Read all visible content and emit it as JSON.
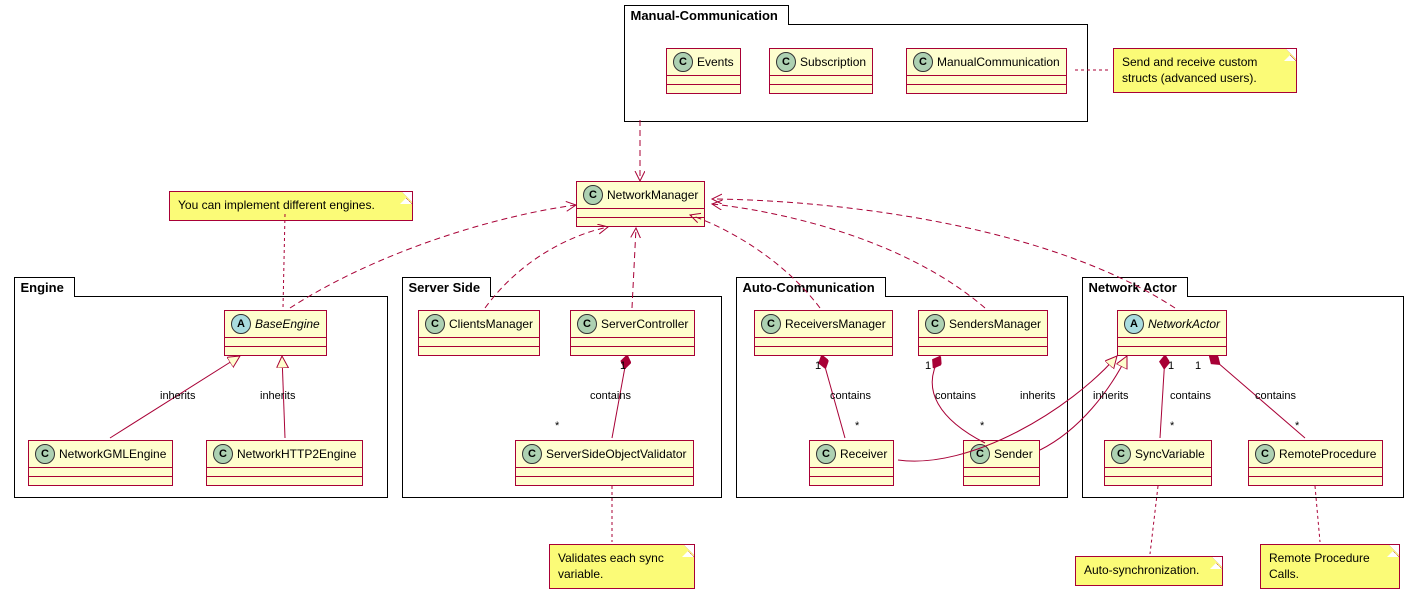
{
  "packages": {
    "manual": {
      "title": "Manual-Communication"
    },
    "engine": {
      "title": "Engine"
    },
    "server": {
      "title": "Server Side"
    },
    "auto": {
      "title": "Auto-Communication"
    },
    "actor": {
      "title": "Network Actor"
    }
  },
  "classes": {
    "events": {
      "name": "Events",
      "stereo": "C"
    },
    "subscription": {
      "name": "Subscription",
      "stereo": "C"
    },
    "manualcomm": {
      "name": "ManualCommunication",
      "stereo": "C"
    },
    "networkmgr": {
      "name": "NetworkManager",
      "stereo": "C"
    },
    "baseengine": {
      "name": "BaseEngine",
      "stereo": "A"
    },
    "gmlengine": {
      "name": "NetworkGMLEngine",
      "stereo": "C"
    },
    "http2engine": {
      "name": "NetworkHTTP2Engine",
      "stereo": "C"
    },
    "clientsmgr": {
      "name": "ClientsManager",
      "stereo": "C"
    },
    "serverctrl": {
      "name": "ServerController",
      "stereo": "C"
    },
    "ssvalidator": {
      "name": "ServerSideObjectValidator",
      "stereo": "C"
    },
    "recvmgr": {
      "name": "ReceiversManager",
      "stereo": "C"
    },
    "sendmgr": {
      "name": "SendersManager",
      "stereo": "C"
    },
    "receiver": {
      "name": "Receiver",
      "stereo": "C"
    },
    "sender": {
      "name": "Sender",
      "stereo": "C"
    },
    "netactor": {
      "name": "NetworkActor",
      "stereo": "A"
    },
    "syncvar": {
      "name": "SyncVariable",
      "stereo": "C"
    },
    "remoteproc": {
      "name": "RemoteProcedure",
      "stereo": "C"
    }
  },
  "notes": {
    "manualcomm_note": "Send and receive custom\nstructs (advanced users).",
    "engine_note": "You can implement different engines.",
    "validator_note": "Validates each sync\nvariable.",
    "syncvar_note": "Auto-synchronization.",
    "remoteproc_note": "Remote Procedure\nCalls."
  },
  "edge_labels": {
    "inherits": "inherits",
    "contains": "contains",
    "one": "1",
    "many": "*"
  },
  "relationships": [
    {
      "from": "Manual-Communication package",
      "to": "NetworkManager",
      "type": "dependency-dashed"
    },
    {
      "from": "BaseEngine",
      "to": "NetworkManager",
      "type": "dependency-dashed"
    },
    {
      "from": "ClientsManager",
      "to": "NetworkManager",
      "type": "dependency-dashed"
    },
    {
      "from": "ServerController",
      "to": "NetworkManager",
      "type": "dependency-dashed"
    },
    {
      "from": "ReceiversManager",
      "to": "NetworkManager",
      "type": "dependency-dashed"
    },
    {
      "from": "SendersManager",
      "to": "NetworkManager",
      "type": "dependency-dashed"
    },
    {
      "from": "NetworkActor",
      "to": "NetworkManager",
      "type": "dependency-dashed"
    },
    {
      "from": "NetworkGMLEngine",
      "to": "BaseEngine",
      "type": "generalization",
      "label": "inherits"
    },
    {
      "from": "NetworkHTTP2Engine",
      "to": "BaseEngine",
      "type": "generalization",
      "label": "inherits"
    },
    {
      "from": "ServerController",
      "to": "ServerSideObjectValidator",
      "type": "composition",
      "label": "contains",
      "mult_from": "1",
      "mult_to": "*"
    },
    {
      "from": "ReceiversManager",
      "to": "Receiver",
      "type": "composition",
      "label": "contains",
      "mult_from": "1",
      "mult_to": "*"
    },
    {
      "from": "SendersManager",
      "to": "Sender",
      "type": "composition",
      "label": "contains",
      "mult_from": "1",
      "mult_to": "*"
    },
    {
      "from": "Receiver",
      "to": "NetworkActor",
      "type": "generalization",
      "label": "inherits"
    },
    {
      "from": "Sender",
      "to": "NetworkActor",
      "type": "generalization",
      "label": "inherits"
    },
    {
      "from": "NetworkActor",
      "to": "SyncVariable",
      "type": "composition",
      "label": "contains",
      "mult_from": "1",
      "mult_to": "*"
    },
    {
      "from": "NetworkActor",
      "to": "RemoteProcedure",
      "type": "composition",
      "label": "contains",
      "mult_from": "1",
      "mult_to": "*"
    }
  ]
}
